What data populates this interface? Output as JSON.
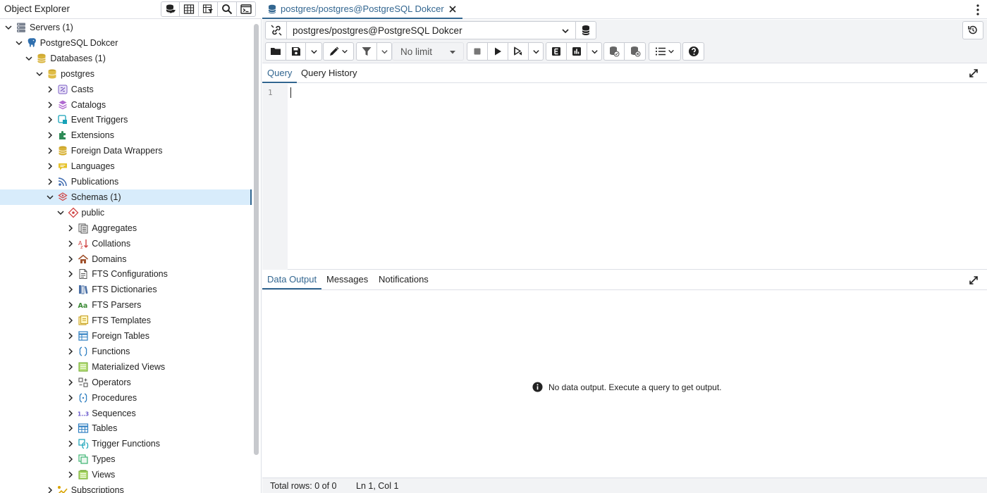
{
  "object_explorer": {
    "title": "Object Explorer",
    "tools": [
      {
        "name": "query-tool-icon",
        "label": "Query Tool"
      },
      {
        "name": "view-data-icon",
        "label": "View Data"
      },
      {
        "name": "filtered-rows-icon",
        "label": "Filtered Rows"
      },
      {
        "name": "search-objects-icon",
        "label": "Search Objects"
      },
      {
        "name": "psql-tool-icon",
        "label": "PSQL Tool"
      }
    ],
    "tree": [
      {
        "label": "Servers (1)",
        "icon": "servers-icon",
        "level": 0,
        "expanded": true
      },
      {
        "label": "PostgreSQL Dokcer",
        "icon": "elephant-server-icon",
        "level": 1,
        "expanded": true
      },
      {
        "label": "Databases (1)",
        "icon": "databases-icon",
        "level": 2,
        "expanded": true
      },
      {
        "label": "postgres",
        "icon": "database-icon",
        "level": 3,
        "expanded": true
      },
      {
        "label": "Casts",
        "icon": "casts-icon",
        "level": 4,
        "expanded": false
      },
      {
        "label": "Catalogs",
        "icon": "catalogs-icon",
        "level": 4,
        "expanded": false
      },
      {
        "label": "Event Triggers",
        "icon": "event-triggers-icon",
        "level": 4,
        "expanded": false
      },
      {
        "label": "Extensions",
        "icon": "extensions-icon",
        "level": 4,
        "expanded": false
      },
      {
        "label": "Foreign Data Wrappers",
        "icon": "foreign-data-wrappers-icon",
        "level": 4,
        "expanded": false
      },
      {
        "label": "Languages",
        "icon": "languages-icon",
        "level": 4,
        "expanded": false
      },
      {
        "label": "Publications",
        "icon": "publications-icon",
        "level": 4,
        "expanded": false
      },
      {
        "label": "Schemas (1)",
        "icon": "schemas-icon",
        "level": 4,
        "expanded": true,
        "selected": true
      },
      {
        "label": "public",
        "icon": "schema-public-icon",
        "level": 5,
        "expanded": true
      },
      {
        "label": "Aggregates",
        "icon": "aggregates-icon",
        "level": 6,
        "expanded": false
      },
      {
        "label": "Collations",
        "icon": "collations-icon",
        "level": 6,
        "expanded": false
      },
      {
        "label": "Domains",
        "icon": "domains-icon",
        "level": 6,
        "expanded": false
      },
      {
        "label": "FTS Configurations",
        "icon": "fts-configurations-icon",
        "level": 6,
        "expanded": false
      },
      {
        "label": "FTS Dictionaries",
        "icon": "fts-dictionaries-icon",
        "level": 6,
        "expanded": false
      },
      {
        "label": "FTS Parsers",
        "icon": "fts-parsers-icon",
        "level": 6,
        "expanded": false
      },
      {
        "label": "FTS Templates",
        "icon": "fts-templates-icon",
        "level": 6,
        "expanded": false
      },
      {
        "label": "Foreign Tables",
        "icon": "foreign-tables-icon",
        "level": 6,
        "expanded": false
      },
      {
        "label": "Functions",
        "icon": "functions-icon",
        "level": 6,
        "expanded": false
      },
      {
        "label": "Materialized Views",
        "icon": "materialized-views-icon",
        "level": 6,
        "expanded": false
      },
      {
        "label": "Operators",
        "icon": "operators-icon",
        "level": 6,
        "expanded": false
      },
      {
        "label": "Procedures",
        "icon": "procedures-icon",
        "level": 6,
        "expanded": false
      },
      {
        "label": "Sequences",
        "icon": "sequences-icon",
        "level": 6,
        "expanded": false
      },
      {
        "label": "Tables",
        "icon": "tables-icon",
        "level": 6,
        "expanded": false
      },
      {
        "label": "Trigger Functions",
        "icon": "trigger-functions-icon",
        "level": 6,
        "expanded": false
      },
      {
        "label": "Types",
        "icon": "types-icon",
        "level": 6,
        "expanded": false
      },
      {
        "label": "Views",
        "icon": "views-icon",
        "level": 6,
        "expanded": false
      },
      {
        "label": "Subscriptions",
        "icon": "subscriptions-icon",
        "level": 4,
        "expanded": false
      }
    ]
  },
  "query_tab": {
    "title": "postgres/postgres@PostgreSQL Dokcer"
  },
  "connection": {
    "selected": "postgres/postgres@PostgreSQL Dokcer"
  },
  "toolbar": {
    "limit_label": "No limit"
  },
  "editor_tabs": [
    {
      "label": "Query",
      "active": true
    },
    {
      "label": "Query History",
      "active": false
    }
  ],
  "editor": {
    "line_numbers": [
      "1"
    ],
    "content": ""
  },
  "output_tabs": [
    {
      "label": "Data Output",
      "active": true
    },
    {
      "label": "Messages",
      "active": false
    },
    {
      "label": "Notifications",
      "active": false
    }
  ],
  "output": {
    "empty_message": "No data output. Execute a query to get output."
  },
  "status": {
    "total_rows": "Total rows: 0 of 0",
    "cursor_position": "Ln 1, Col 1"
  },
  "colors": {
    "accent": "#326690",
    "selected_row": "#d8ecfb",
    "panel_bg": "#f2f3f5",
    "border": "#dde0e6"
  }
}
